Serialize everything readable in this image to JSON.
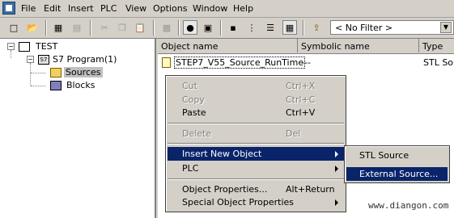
{
  "menubar": {
    "items": [
      "File",
      "Edit",
      "Insert",
      "PLC",
      "View",
      "Options",
      "Window",
      "Help"
    ]
  },
  "toolbar": {
    "filter_value": "< No Filter >"
  },
  "tree": {
    "root": "TEST",
    "program": "S7 Program(1)",
    "sources": "Sources",
    "blocks": "Blocks",
    "s7_badge": "S7"
  },
  "list": {
    "columns": [
      "Object name",
      "Symbolic name",
      "Type"
    ],
    "rows": [
      {
        "name": "STEP7_V55_Source_RunTime",
        "symbolic": "---",
        "type": "STL Source"
      }
    ]
  },
  "context_menu": {
    "cut": {
      "label": "Cut",
      "shortcut": "Ctrl+X"
    },
    "copy": {
      "label": "Copy",
      "shortcut": "Ctrl+C"
    },
    "paste": {
      "label": "Paste",
      "shortcut": "Ctrl+V"
    },
    "delete": {
      "label": "Delete",
      "shortcut": "Del"
    },
    "insert_new_object": {
      "label": "Insert New Object"
    },
    "plc": {
      "label": "PLC"
    },
    "object_properties": {
      "label": "Object Properties...",
      "shortcut": "Alt+Return"
    },
    "special_object_properties": {
      "label": "Special Object Properties"
    }
  },
  "submenu": {
    "stl_source": "STL Source",
    "external_source": "External Source..."
  },
  "watermark": "www.diangon.com",
  "colors": {
    "highlight": "#0a246a",
    "face": "#d4d0c8"
  }
}
